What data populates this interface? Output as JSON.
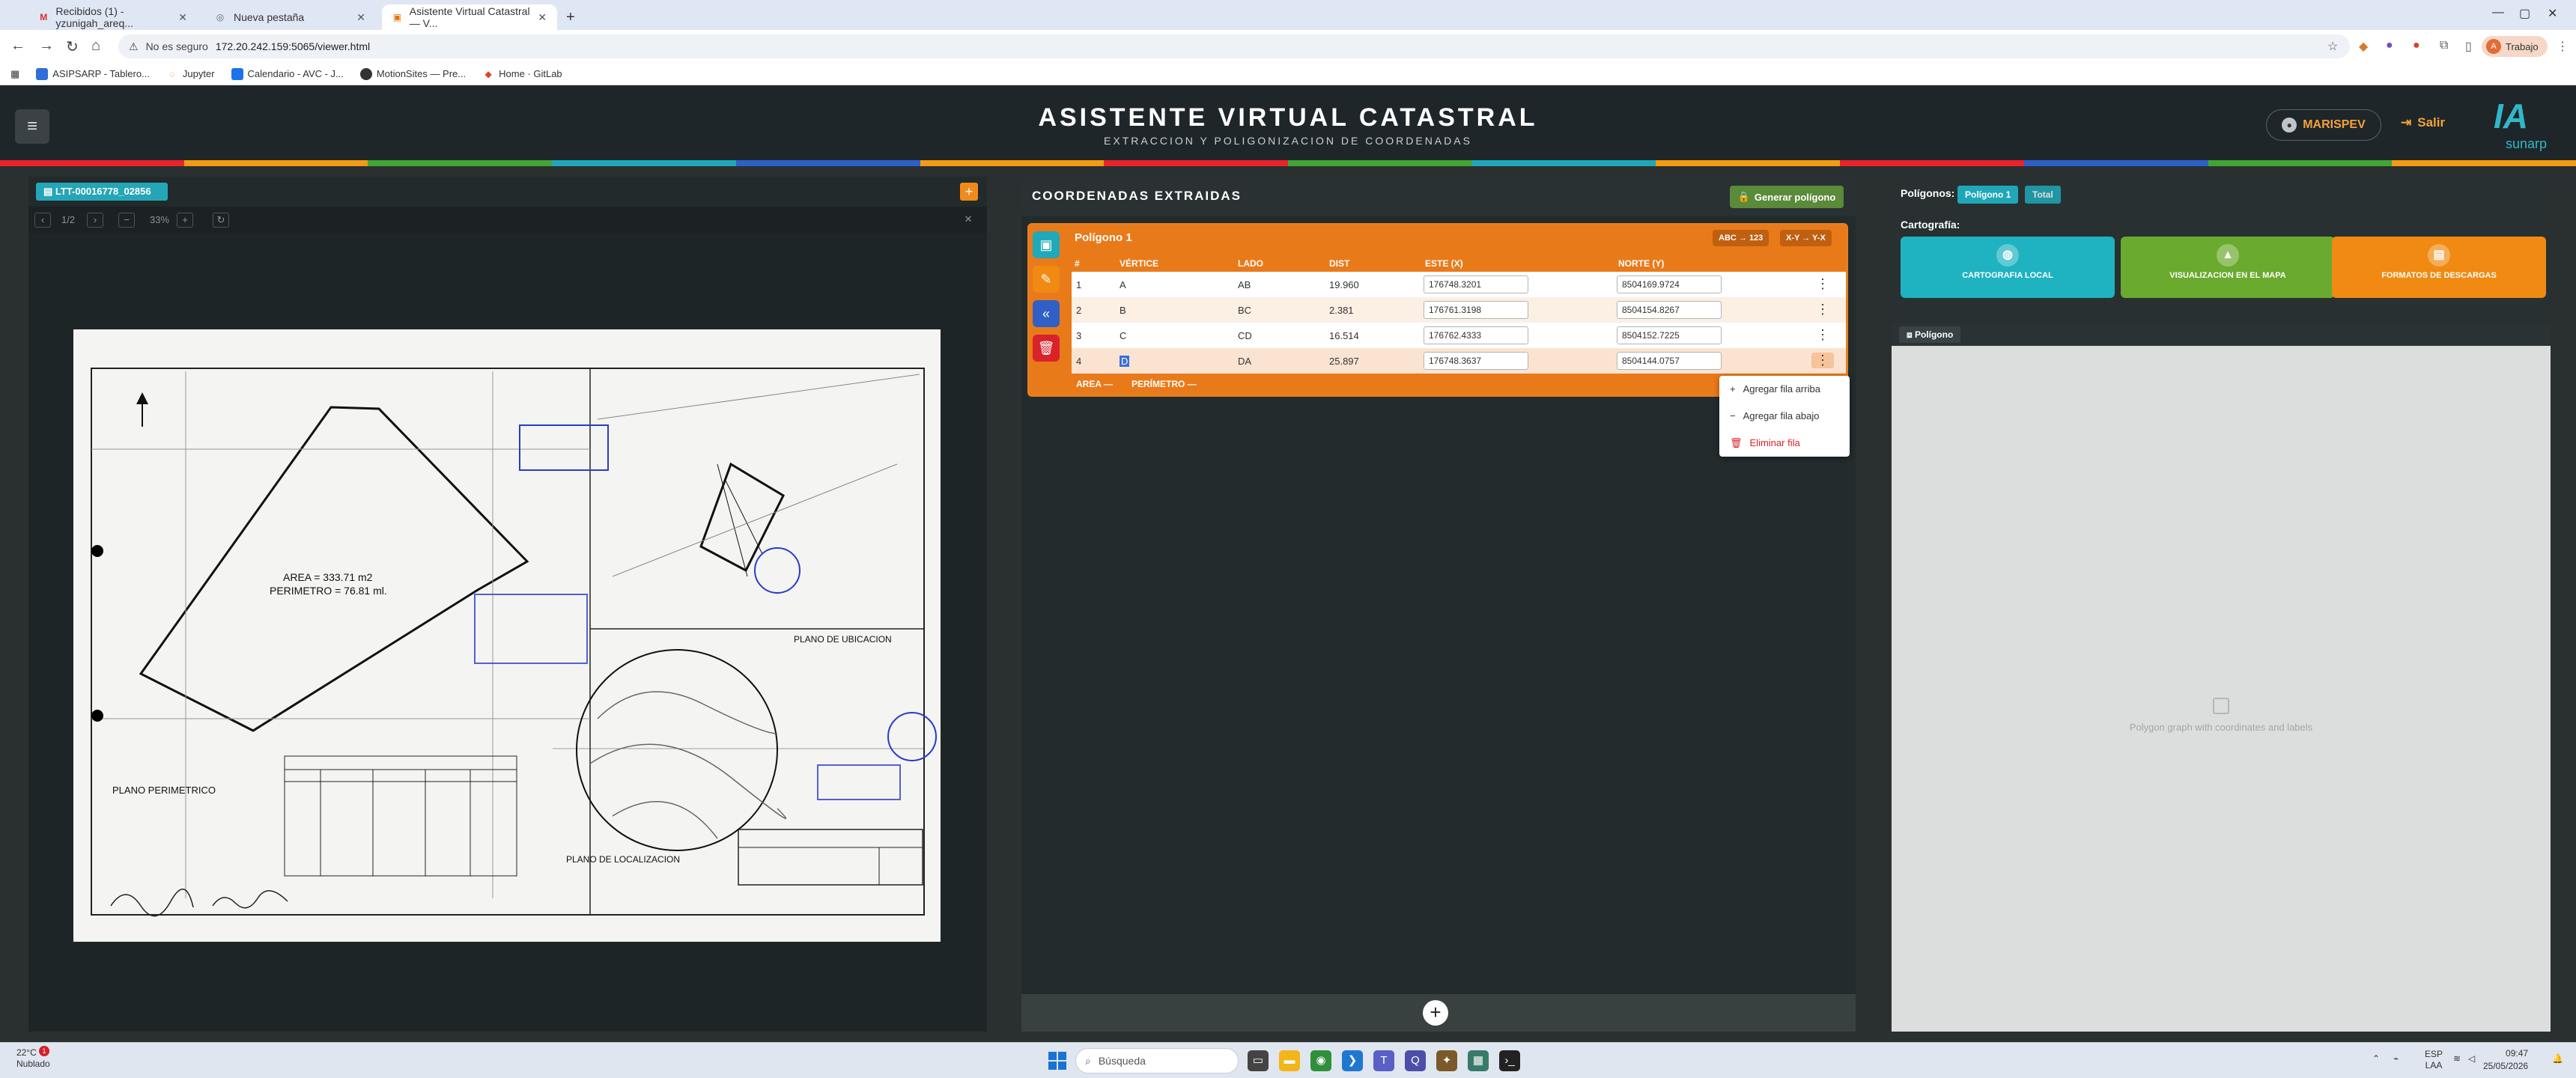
{
  "browser": {
    "tabs": [
      {
        "title": "Recibidos (1) - yzunigah_areq...",
        "icon": "gmail-icon",
        "icon_color": "#d93025"
      },
      {
        "title": "Nueva pestaña",
        "icon": "globe-icon",
        "icon_color": "#666666"
      },
      {
        "title": "Asistente Virtual Catastral — V...",
        "icon": "document-icon",
        "icon_color": "#e37400"
      }
    ],
    "new_tab": "+",
    "security_label": "No es seguro",
    "url": "172.20.242.159:5065/viewer.html",
    "profile": "Trabajo",
    "profile_initial": "A",
    "bookmarks": [
      "ASIPSARP - Tablero...",
      "Jupyter",
      "Calendario - AVC - J...",
      "MotionSites — Pre...",
      "Home · GitLab"
    ]
  },
  "app": {
    "title": "ASISTENTE VIRTUAL CATASTRAL",
    "subtitle": "EXTRACCION Y POLIGONIZACION DE COORDENADAS",
    "user": "MARISPEV",
    "logout": "Salir",
    "logo_main": "IA",
    "logo_sub": "sunarp",
    "stripe_colors": [
      "#e9232b",
      "#f39c12",
      "#41a535",
      "#1fa7b8",
      "#2f5fc7",
      "#f39c12",
      "#e9232b",
      "#41a535",
      "#1fa7b8",
      "#f39c12",
      "#e9232b",
      "#2f5fc7",
      "#41a535",
      "#f39c12"
    ]
  },
  "viewer": {
    "file_name": "LTT-00016778_02856",
    "page": "1/2",
    "zoom": "33%"
  },
  "coords": {
    "title": "COORDENADAS EXTRAIDAS",
    "generate_button": "Generar polígono",
    "polygon_title": "Polígono 1",
    "tag_abc": "ABC → 123",
    "tag_xy": "X-Y → Y-X",
    "columns": [
      "#",
      "VÉRTICE",
      "LADO",
      "DIST",
      "ESTE (X)",
      "NORTE (Y)"
    ],
    "rows": [
      {
        "n": "1",
        "vertice": "A",
        "lado": "AB",
        "dist": "19.960",
        "este": "176748.3201",
        "norte": "8504169.9724"
      },
      {
        "n": "2",
        "vertice": "B",
        "lado": "BC",
        "dist": "2.381",
        "este": "176761.3198",
        "norte": "8504154.8267"
      },
      {
        "n": "3",
        "vertice": "C",
        "lado": "CD",
        "dist": "16.514",
        "este": "176762.4333",
        "norte": "8504152.7225"
      },
      {
        "n": "4",
        "vertice": "D",
        "lado": "DA",
        "dist": "25.897",
        "este": "176748.3637",
        "norte": "8504144.0757"
      }
    ],
    "footer_area": "AREA —",
    "footer_perimetro": "PERÍMETRO —",
    "context_menu": [
      "Agregar fila arriba",
      "Agregar fila abajo",
      "Eliminar fila"
    ],
    "add_button": "+"
  },
  "carto": {
    "polygons_label": "Polígonos:",
    "tab_poly": "Polígono 1",
    "tab_total": "Total",
    "cartografia_label": "Cartografía:",
    "buttons": [
      {
        "label": "CARTOGRAFIA LOCAL",
        "color": "#1fb3c2"
      },
      {
        "label": "VISUALIZACION EN EL MAPA",
        "color": "#6aaa2e"
      },
      {
        "label": "FORMATOS DE DESCARGAS",
        "color": "#f08a12"
      }
    ],
    "polygon_tab": "Polígono",
    "placeholder": "Polygon graph with coordinates and labels"
  },
  "taskbar": {
    "temperature": "22°C",
    "weather": "Nublado",
    "badge": "1",
    "search": "Búsqueda",
    "lang": "ESP",
    "lang2": "LAA",
    "time": "09:47",
    "date": "25/05/2026"
  }
}
